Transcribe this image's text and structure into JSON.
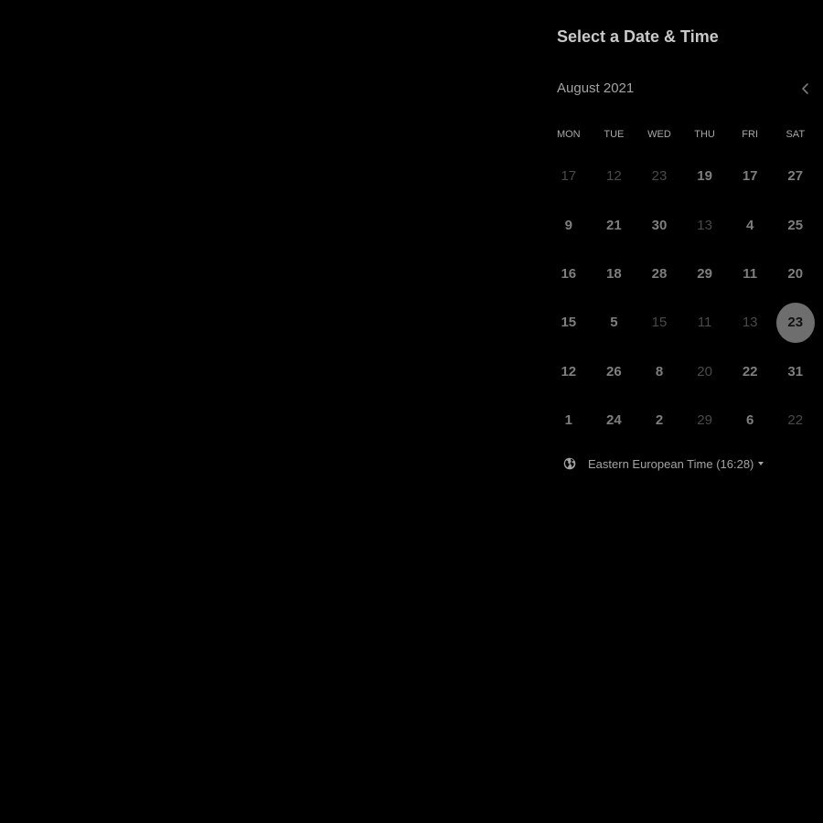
{
  "header": {
    "title": "Select a Date & Time"
  },
  "calendar": {
    "month_label": "August 2021",
    "prev_icon": "chevron-left-icon",
    "weekdays": [
      "MON",
      "TUE",
      "WED",
      "THU",
      "FRI",
      "SAT"
    ],
    "weeks": [
      [
        {
          "day": "17",
          "available": false
        },
        {
          "day": "12",
          "available": false
        },
        {
          "day": "23",
          "available": false
        },
        {
          "day": "19",
          "available": true
        },
        {
          "day": "17",
          "available": true
        },
        {
          "day": "27",
          "available": true
        }
      ],
      [
        {
          "day": "9",
          "available": true
        },
        {
          "day": "21",
          "available": true
        },
        {
          "day": "30",
          "available": true
        },
        {
          "day": "13",
          "available": false
        },
        {
          "day": "4",
          "available": true
        },
        {
          "day": "25",
          "available": true
        }
      ],
      [
        {
          "day": "16",
          "available": true
        },
        {
          "day": "18",
          "available": true
        },
        {
          "day": "28",
          "available": true
        },
        {
          "day": "29",
          "available": true
        },
        {
          "day": "11",
          "available": true
        },
        {
          "day": "20",
          "available": true
        }
      ],
      [
        {
          "day": "15",
          "available": true
        },
        {
          "day": "5",
          "available": true
        },
        {
          "day": "15",
          "available": false
        },
        {
          "day": "11",
          "available": false
        },
        {
          "day": "13",
          "available": false
        },
        {
          "day": "23",
          "available": true,
          "selected": true
        }
      ],
      [
        {
          "day": "12",
          "available": true
        },
        {
          "day": "26",
          "available": true
        },
        {
          "day": "8",
          "available": true
        },
        {
          "day": "20",
          "available": false
        },
        {
          "day": "22",
          "available": true
        },
        {
          "day": "31",
          "available": true
        }
      ],
      [
        {
          "day": "1",
          "available": true
        },
        {
          "day": "24",
          "available": true
        },
        {
          "day": "2",
          "available": true
        },
        {
          "day": "29",
          "available": false
        },
        {
          "day": "6",
          "available": true
        },
        {
          "day": "22",
          "available": false
        }
      ]
    ]
  },
  "timezone": {
    "icon": "globe-icon",
    "label": "Eastern European Time (16:28)",
    "caret_icon": "caret-down-icon"
  },
  "colors": {
    "background": "#000000",
    "title": "#c9c9c9",
    "available_day": "#7e7e7e",
    "unavailable_day": "#4a4a4a",
    "selected_day_background": "#6e6e6e"
  }
}
